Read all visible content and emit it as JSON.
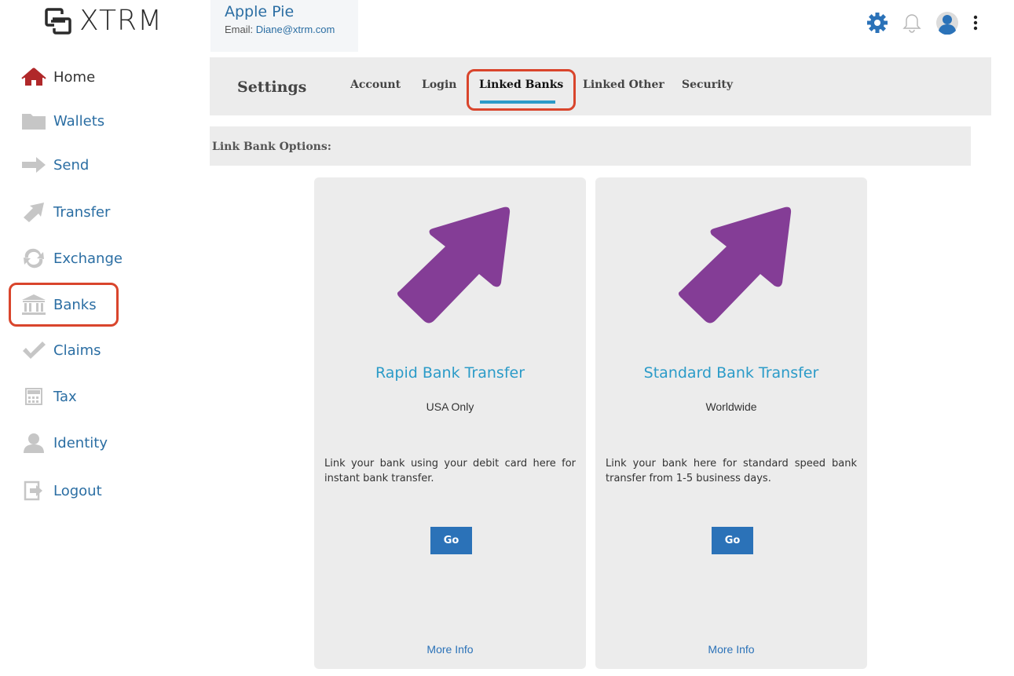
{
  "app": {
    "logo_text": "XTRM"
  },
  "user": {
    "name": "Apple Pie",
    "email_label": "Email: ",
    "email": "Diane@xtrm.com"
  },
  "sidebar": {
    "items": [
      {
        "label": "Home",
        "icon": "home-icon"
      },
      {
        "label": "Wallets",
        "icon": "folder-icon"
      },
      {
        "label": "Send",
        "icon": "arrow-right-icon"
      },
      {
        "label": "Transfer",
        "icon": "transfer-arrow-icon"
      },
      {
        "label": "Exchange",
        "icon": "exchange-icon"
      },
      {
        "label": "Banks",
        "icon": "bank-icon"
      },
      {
        "label": "Claims",
        "icon": "checkmark-icon"
      },
      {
        "label": "Tax",
        "icon": "calculator-icon"
      },
      {
        "label": "Identity",
        "icon": "person-icon"
      },
      {
        "label": "Logout",
        "icon": "logout-icon"
      }
    ]
  },
  "settings": {
    "title": "Settings",
    "tabs": [
      {
        "label": "Account"
      },
      {
        "label": "Login"
      },
      {
        "label": "Linked Banks",
        "active": true
      },
      {
        "label": "Linked Other"
      },
      {
        "label": "Security"
      }
    ]
  },
  "link_bank": {
    "options_label": "Link Bank Options:",
    "cards": [
      {
        "title": "Rapid Bank Transfer",
        "subtitle": "USA Only",
        "description": "Link your bank using your debit card here for instant bank transfer.",
        "button": "Go",
        "more_info": "More Info"
      },
      {
        "title": "Standard Bank Transfer",
        "subtitle": "Worldwide",
        "description": "Link your bank here for standard speed bank transfer from 1-5 business days.",
        "button": "Go",
        "more_info": "More Info"
      }
    ]
  },
  "colors": {
    "accent": "#2b9bc8",
    "link": "#2b6ea3",
    "button": "#2b72b8",
    "arrow": "#843d96",
    "highlight": "#d9452c",
    "home_icon": "#b0282a"
  }
}
